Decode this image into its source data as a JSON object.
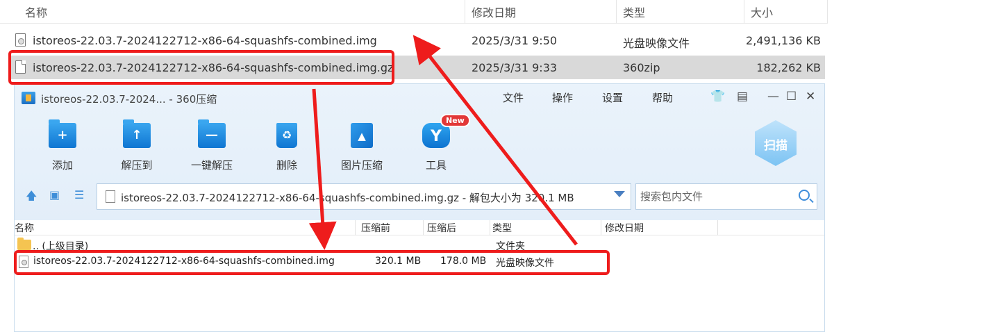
{
  "explorer": {
    "columns": {
      "name": "名称",
      "modified": "修改日期",
      "type": "类型",
      "size": "大小"
    },
    "rows": [
      {
        "name": "istoreos-22.03.7-2024122712-x86-64-squashfs-combined.img",
        "modified": "2025/3/31 9:50",
        "type": "光盘映像文件",
        "size": "2,491,136 KB",
        "icon": "disc-image-file-icon"
      },
      {
        "name": "istoreos-22.03.7-2024122712-x86-64-squashfs-combined.img.gz",
        "modified": "2025/3/31 9:33",
        "type": "360zip",
        "size": "182,262 KB",
        "icon": "file-icon"
      }
    ]
  },
  "zip_window": {
    "title": "istoreos-22.03.7-2024... - 360压缩",
    "menu": [
      "文件",
      "操作",
      "设置",
      "帮助"
    ],
    "toolbar": {
      "add": "添加",
      "extract_to": "解压到",
      "one_click_extract": "一键解压",
      "delete": "删除",
      "image_compress": "图片压缩",
      "tools": "工具",
      "tools_badge": "New",
      "scan": "扫描"
    },
    "path_text": "istoreos-22.03.7-2024122712-x86-64-squashfs-combined.img.gz - 解包大小为 320.1 MB",
    "search_placeholder": "搜索包内文件",
    "list_columns": {
      "name": "名称",
      "original": "压缩前",
      "compressed": "压缩后",
      "type": "类型",
      "modified": "修改日期"
    },
    "rows": [
      {
        "name": ".. (上级目录)",
        "original": "",
        "compressed": "",
        "type": "文件夹"
      },
      {
        "name": "istoreos-22.03.7-2024122712-x86-64-squashfs-combined.img",
        "original": "320.1 MB",
        "compressed": "178.0 MB",
        "type": "光盘映像文件"
      }
    ]
  },
  "colors": {
    "highlight": "#ee1c1c",
    "accent": "#1a80d8",
    "selected_row": "#d9d9d9"
  }
}
